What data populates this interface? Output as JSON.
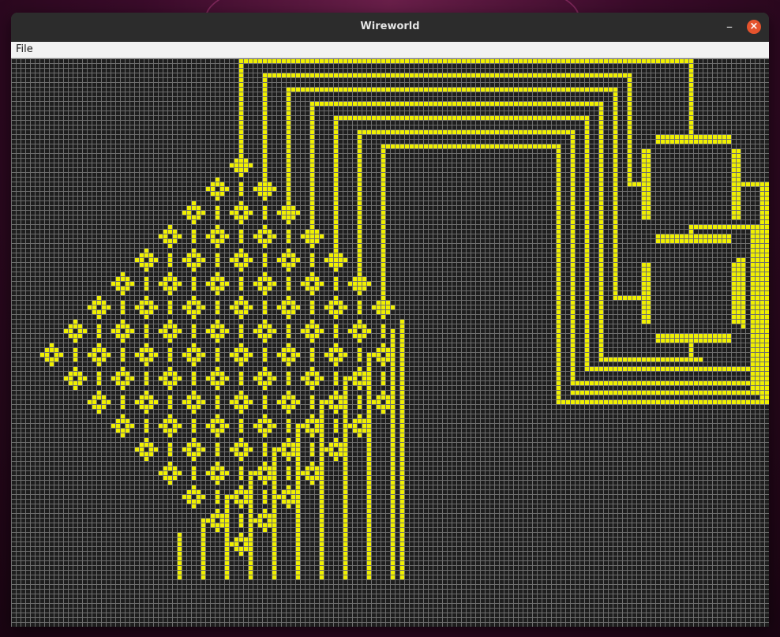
{
  "window": {
    "title": "Wireworld"
  },
  "menu": {
    "items": [
      "File"
    ]
  },
  "colors": {
    "background": "#1e1e1e",
    "grid": "#6e6e6e",
    "conductor": "#f0f000",
    "close_button": "#e5532d"
  },
  "icons": {
    "minimize": "minimize-icon",
    "close": "close-icon"
  }
}
